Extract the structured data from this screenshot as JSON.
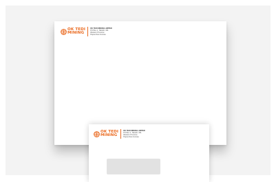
{
  "brand": {
    "word_top": "OK TEDI",
    "word_bottom": "MINING",
    "mark": "ok-tedi-globe-icon",
    "color": "#ea6a20"
  },
  "large_envelope": {
    "address_lines": [
      "OK TEDI MINING LIMITED",
      "PO Box 1, Tabubil, 331",
      "Western Province",
      "Papua New Guinea"
    ]
  },
  "small_envelope": {
    "address_lines": [
      "OK TEDI MINING LIMITED",
      "PO Box 1, Tabubil, 331",
      "Western Province",
      "Papua New Guinea"
    ]
  },
  "colors": {
    "backdrop": "#f3f3f3",
    "window": "#e2e2e2"
  }
}
